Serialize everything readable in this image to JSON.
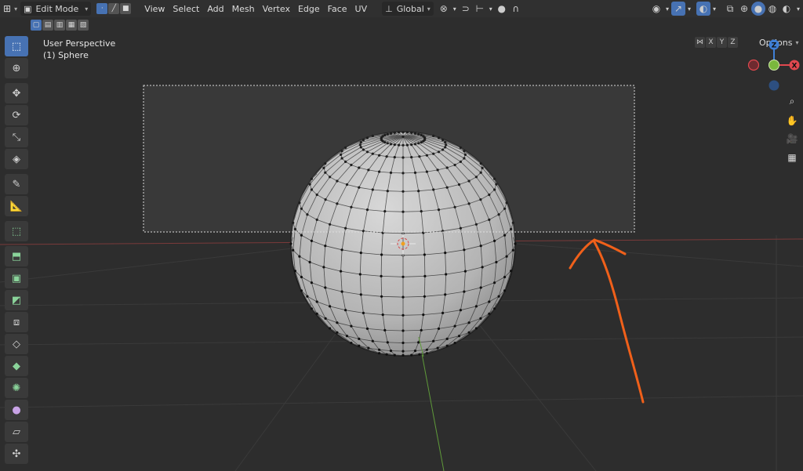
{
  "header": {
    "mode_label": "Edit Mode",
    "menus": [
      "View",
      "Select",
      "Add",
      "Mesh",
      "Vertex",
      "Edge",
      "Face",
      "UV"
    ],
    "orientation_label": "Global"
  },
  "subheader": {
    "axis_x": "X",
    "axis_y": "Y",
    "axis_z": "Z",
    "options_label": "Options"
  },
  "viewport": {
    "perspective_label": "User Perspective",
    "object_label": "(1) Sphere"
  },
  "gizmo": {
    "z_label": "Z",
    "x_label": "X"
  },
  "colors": {
    "accent": "#4772b3",
    "x_axis": "#e0484f",
    "y_axis": "#7ab83d",
    "z_axis": "#3f7fd6",
    "annotation": "#f0601a"
  }
}
